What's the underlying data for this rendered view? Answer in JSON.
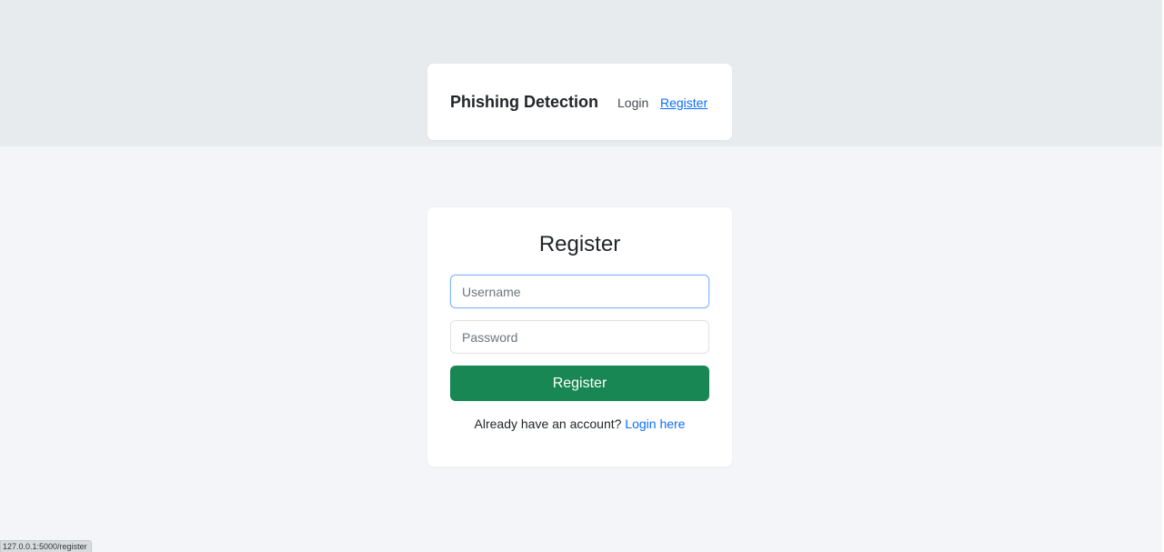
{
  "navbar": {
    "brand": "Phishing Detection",
    "links": [
      {
        "label": "Login"
      },
      {
        "label": "Register"
      }
    ]
  },
  "register_form": {
    "title": "Register",
    "username_placeholder": "Username",
    "username_value": "",
    "password_placeholder": "Password",
    "password_value": "",
    "submit_label": "Register",
    "footer_text": "Already have an account?",
    "footer_link": "Login here"
  },
  "status_bar": {
    "url": "127.0.0.1:5000/register"
  },
  "colors": {
    "accent": "#0d6efd",
    "submit": "#198754",
    "page_bg": "#f3f5f8",
    "header_bg": "#e8ebee"
  }
}
